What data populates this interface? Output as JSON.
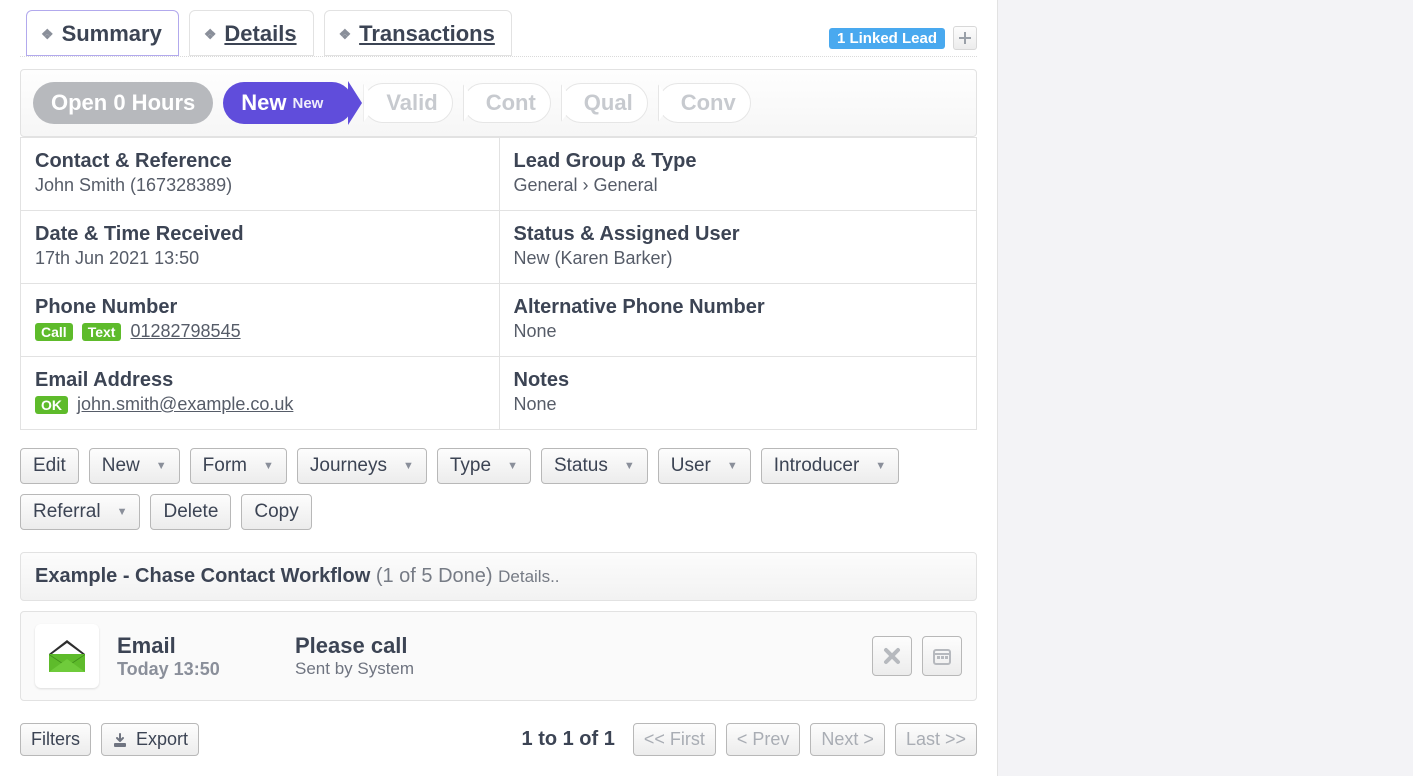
{
  "tabs": {
    "summary": "Summary",
    "details": "Details",
    "transactions": "Transactions"
  },
  "linked_badge": "1 Linked Lead",
  "stages": {
    "open": "Open 0 Hours",
    "new_main": "New",
    "new_sub": "New",
    "valid": "Valid",
    "cont": "Cont",
    "qual": "Qual",
    "conv": "Conv"
  },
  "summary": {
    "contact_ref": {
      "label": "Contact & Reference",
      "value": "John Smith (167328389)"
    },
    "lead_group": {
      "label": "Lead Group & Type",
      "value": "General › General"
    },
    "received": {
      "label": "Date & Time Received",
      "value": "17th Jun 2021 13:50"
    },
    "status_user": {
      "label": "Status & Assigned User",
      "value": "New (Karen Barker)"
    },
    "phone": {
      "label": "Phone Number",
      "call_chip": "Call",
      "text_chip": "Text",
      "value": "01282798545"
    },
    "alt_phone": {
      "label": "Alternative Phone Number",
      "value": "None"
    },
    "email": {
      "label": "Email Address",
      "ok_chip": "OK",
      "value": "john.smith@example.co.uk"
    },
    "notes": {
      "label": "Notes",
      "value": "None"
    }
  },
  "actions": {
    "edit": "Edit",
    "new": "New",
    "form": "Form",
    "journeys": "Journeys",
    "type": "Type",
    "status": "Status",
    "user": "User",
    "introducer": "Introducer",
    "referral": "Referral",
    "delete": "Delete",
    "copy": "Copy"
  },
  "workflow": {
    "title": "Example - Chase Contact Workflow",
    "count": "(1 of 5 Done)",
    "details": "Details..",
    "item": {
      "kind": "Email",
      "time": "Today 13:50",
      "subject": "Please call",
      "by": "Sent by System"
    }
  },
  "footer": {
    "filters": "Filters",
    "export": "Export",
    "range": "1 to 1 of 1",
    "first": "<< First",
    "prev": "< Prev",
    "next": "Next >",
    "last": "Last >>"
  }
}
